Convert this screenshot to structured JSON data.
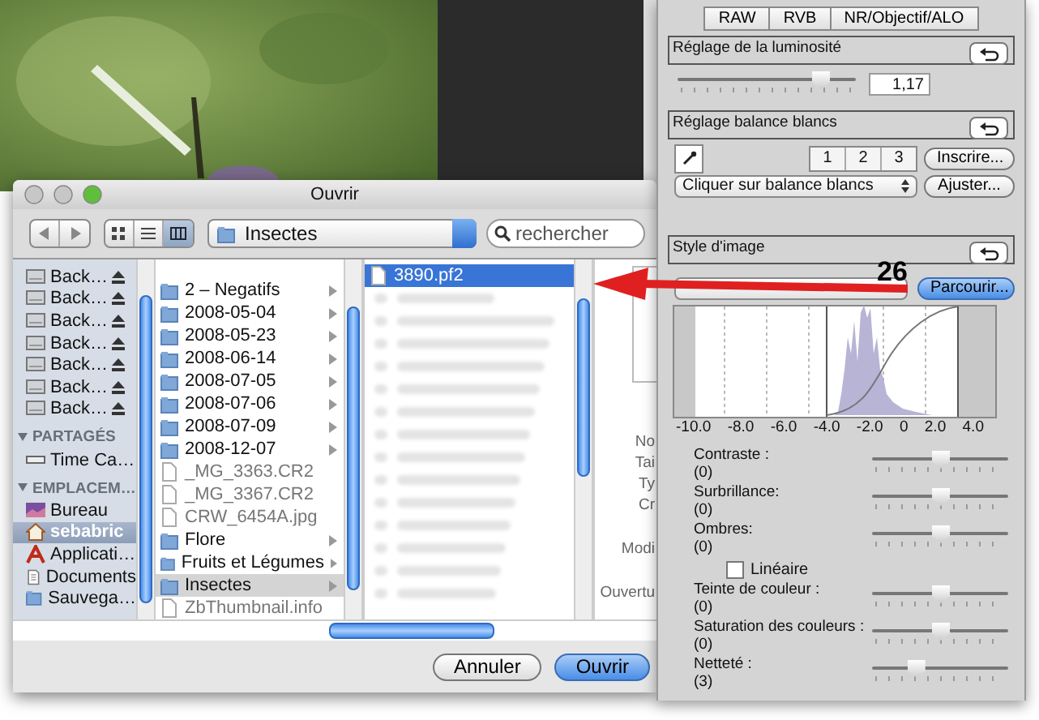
{
  "dialog": {
    "title": "Ouvrir",
    "location": "Insectes",
    "search": {
      "placeholder": "rechercher"
    },
    "view_modes": [
      {
        "kind": "icons",
        "selected": false
      },
      {
        "kind": "list",
        "selected": false
      },
      {
        "kind": "columns",
        "selected": true
      }
    ],
    "sidebar": [
      {
        "kind": "disk",
        "label": "Back…",
        "selected": false
      },
      {
        "kind": "disk",
        "label": "Back…",
        "selected": false
      },
      {
        "kind": "disk",
        "label": "Back…",
        "selected": false
      },
      {
        "kind": "disk",
        "label": "Back…",
        "selected": false
      },
      {
        "kind": "disk",
        "label": "Back…",
        "selected": false
      },
      {
        "kind": "disk",
        "label": "Back…",
        "selected": false
      },
      {
        "kind": "disk",
        "label": "Back…",
        "selected": false
      },
      {
        "kind": "header",
        "label": "PARTAGÉS",
        "selected": false
      },
      {
        "kind": "share",
        "label": "Time Ca…",
        "selected": false
      },
      {
        "kind": "header",
        "label": "EMPLACEM…",
        "selected": false
      },
      {
        "kind": "desktop",
        "label": "Bureau",
        "selected": false
      },
      {
        "kind": "home",
        "label": "sebabric",
        "selected": true
      },
      {
        "kind": "apps",
        "label": "Applicati…",
        "selected": false
      },
      {
        "kind": "docs",
        "label": "Documents",
        "selected": false
      },
      {
        "kind": "folder",
        "label": "Sauvega…",
        "selected": false
      }
    ],
    "column_1": [
      {
        "kind": "folder",
        "name": "2 – Negatifs",
        "selected": false
      },
      {
        "kind": "folder",
        "name": "2008-05-04",
        "selected": false
      },
      {
        "kind": "folder",
        "name": "2008-05-23",
        "selected": false
      },
      {
        "kind": "folder",
        "name": "2008-06-14",
        "selected": false
      },
      {
        "kind": "folder",
        "name": "2008-07-05",
        "selected": false
      },
      {
        "kind": "folder",
        "name": "2008-07-06",
        "selected": false
      },
      {
        "kind": "folder",
        "name": "2008-07-09",
        "selected": false
      },
      {
        "kind": "folder",
        "name": "2008-12-07",
        "selected": false
      },
      {
        "kind": "file",
        "name": "_MG_3363.CR2",
        "selected": false
      },
      {
        "kind": "file",
        "name": "_MG_3367.CR2",
        "selected": false
      },
      {
        "kind": "file",
        "name": "CRW_6454A.jpg",
        "selected": false
      },
      {
        "kind": "folder",
        "name": "Flore",
        "selected": false
      },
      {
        "kind": "folder",
        "name": "Fruits et Légumes",
        "selected": false
      },
      {
        "kind": "folder",
        "name": "Insectes",
        "selected": true
      },
      {
        "kind": "file",
        "name": "ZbThumbnail.info",
        "selected": false
      }
    ],
    "column_2": [
      {
        "name": "3890.pf2",
        "selected": true
      }
    ],
    "preview_labels": [
      "No",
      "Tai",
      "Ty",
      "Cr",
      "Modi",
      "Ouvertu"
    ],
    "buttons": [
      {
        "label": "Annuler",
        "default": false
      },
      {
        "label": "Ouvrir",
        "default": true
      }
    ]
  },
  "panel": {
    "tabs": [
      {
        "label": "RAW",
        "selected": false
      },
      {
        "label": "RVB",
        "selected": false
      },
      {
        "label": "NR/Objectif/ALO",
        "selected": false
      }
    ],
    "brightness": {
      "title": "Réglage de la luminosité",
      "level": 0.8,
      "value": "1,17"
    },
    "white_balance": {
      "title": "Réglage balance blancs",
      "presets": [
        "1",
        "2",
        "3"
      ],
      "register": "Inscrire...",
      "mode": "Cliquer sur balance blancs",
      "adjust": "Ajuster..."
    },
    "picture_style": {
      "title": "Style d'image",
      "browse": "Parcourir...",
      "axis_labels": [
        "-10.0",
        "-8.0",
        "-6.0",
        "-4.0",
        "-2.0",
        "0",
        "2.0",
        "4.0"
      ]
    },
    "adjustments": [
      {
        "kind": "slider",
        "label": "Contraste :",
        "value": "(0)",
        "level": 0.5
      },
      {
        "kind": "slider",
        "label": "Surbrillance:",
        "value": "(0)",
        "level": 0.5
      },
      {
        "kind": "slider",
        "label": "Ombres:",
        "value": "(0)",
        "level": 0.5
      },
      {
        "kind": "checkbox",
        "label": "Linéaire",
        "checked": false
      },
      {
        "kind": "slider",
        "label": "Teinte de couleur :",
        "value": "(0)",
        "level": 0.5
      },
      {
        "kind": "slider",
        "label": "Saturation des couleurs :",
        "value": "(0)",
        "level": 0.5
      },
      {
        "kind": "slider",
        "label": "Netteté :",
        "value": "(3)",
        "level": 0.32
      }
    ]
  },
  "callout": {
    "number": "26"
  }
}
